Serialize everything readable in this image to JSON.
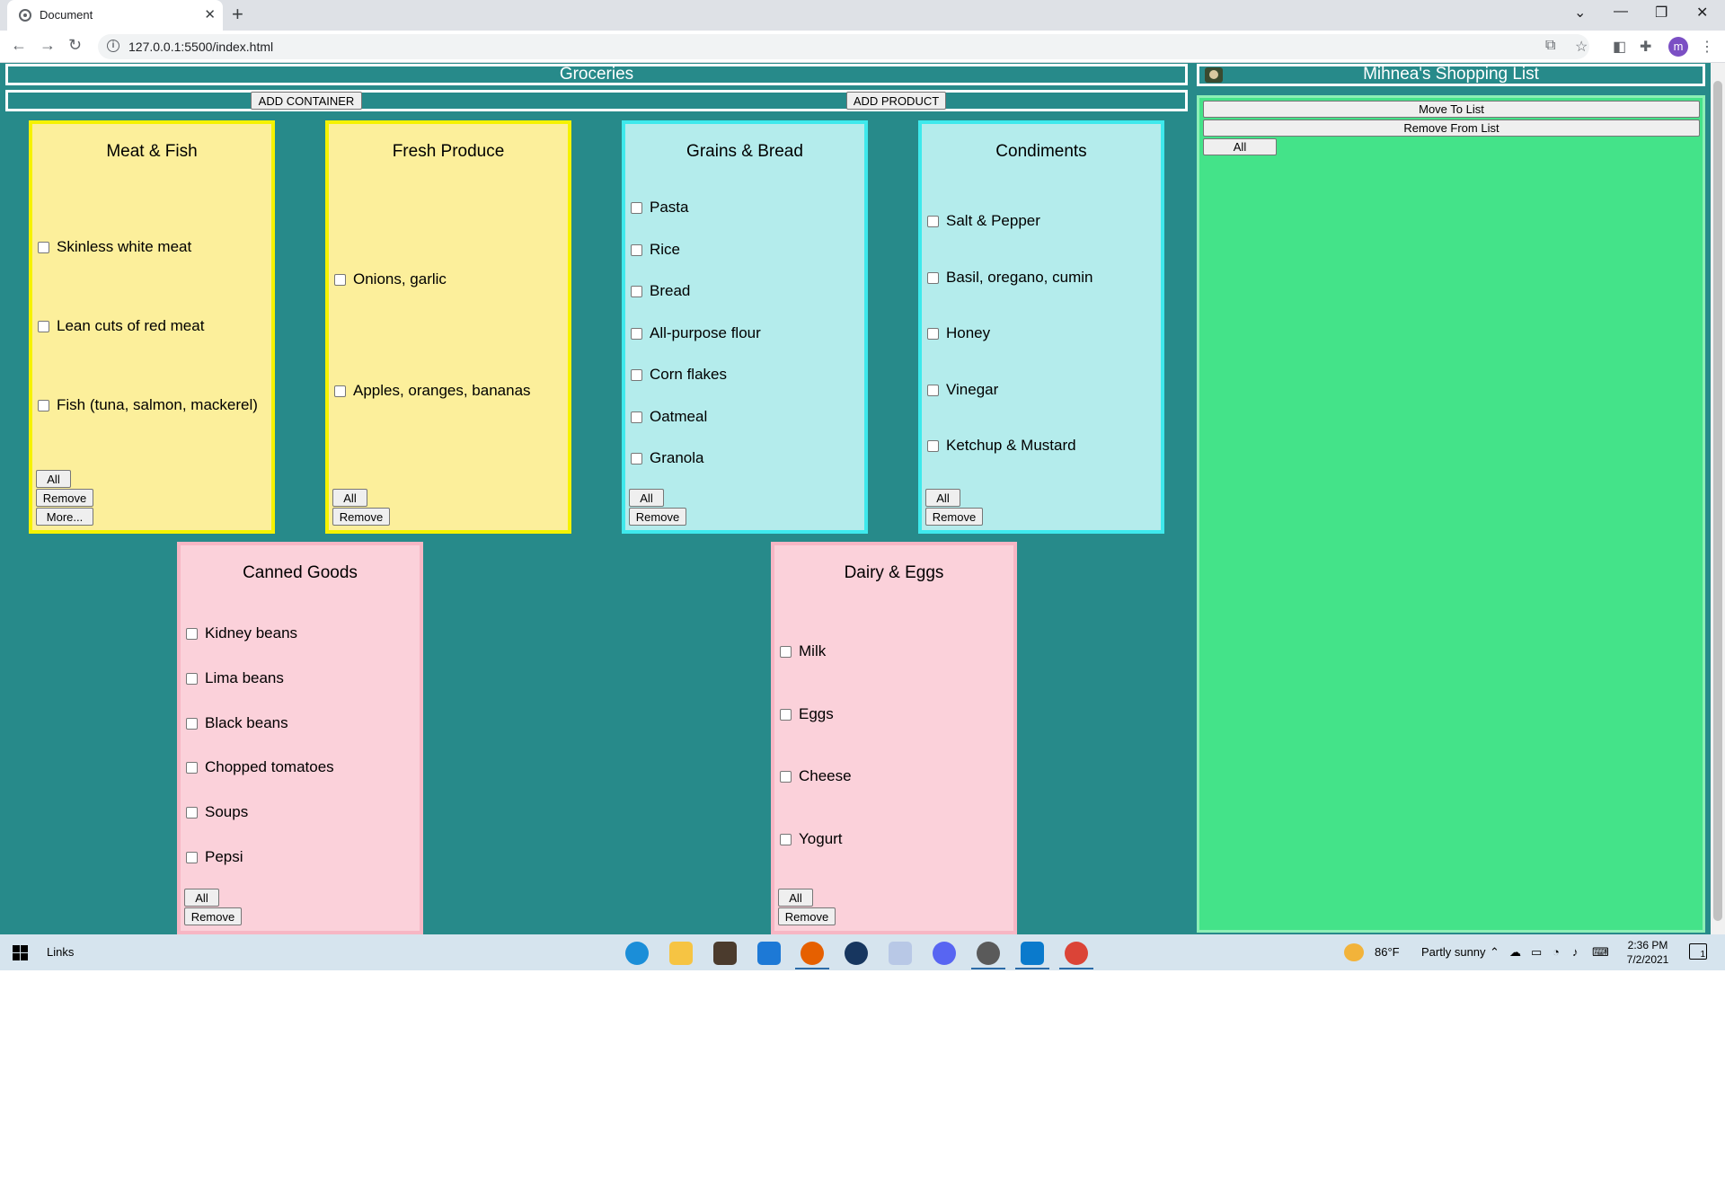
{
  "browser": {
    "tab_title": "Document",
    "tab_close": "✕",
    "new_tab": "+",
    "url": "127.0.0.1:5500/index.html",
    "profile_initial": "m",
    "window_controls": {
      "tab_search": "⌄",
      "minimize": "—",
      "restore": "❐",
      "close": "✕"
    },
    "nav": {
      "back": "←",
      "forward": "→",
      "reload": "↻"
    },
    "toolbar_icons": [
      "translate-icon",
      "star-icon",
      "extension-icon",
      "puzzle-icon",
      "menu-icon"
    ]
  },
  "page": {
    "header_title": "Groceries",
    "add_container_label": "ADD CONTAINER",
    "add_product_label": "ADD PRODUCT",
    "containers": [
      {
        "title": "Meat & Fish",
        "color": "yellow",
        "items": [
          "Skinless white meat",
          "Lean cuts of red meat",
          "Fish (tuna, salmon, mackerel)"
        ],
        "buttons": [
          "All",
          "Remove",
          "More..."
        ]
      },
      {
        "title": "Fresh Produce",
        "color": "yellow",
        "items": [
          "Onions, garlic",
          "Apples, oranges, bananas"
        ],
        "buttons": [
          "All",
          "Remove"
        ]
      },
      {
        "title": "Grains & Bread",
        "color": "cyan",
        "items": [
          "Pasta",
          "Rice",
          "Bread",
          "All-purpose flour",
          "Corn flakes",
          "Oatmeal",
          "Granola"
        ],
        "buttons": [
          "All",
          "Remove"
        ]
      },
      {
        "title": "Condiments",
        "color": "cyan",
        "items": [
          "Salt & Pepper",
          "Basil, oregano, cumin",
          "Honey",
          "Vinegar",
          "Ketchup & Mustard"
        ],
        "buttons": [
          "All",
          "Remove"
        ]
      },
      {
        "title": "Canned Goods",
        "color": "pink",
        "items": [
          "Kidney beans",
          "Lima beans",
          "Black beans",
          "Chopped tomatoes",
          "Soups",
          "Pepsi"
        ],
        "buttons": [
          "All",
          "Remove"
        ]
      },
      {
        "title": "Dairy & Eggs",
        "color": "pink",
        "items": [
          "Milk",
          "Eggs",
          "Cheese",
          "Yogurt"
        ],
        "buttons": [
          "All",
          "Remove"
        ]
      }
    ],
    "shopping_list": {
      "title": "Mihnea's Shopping List",
      "move_label": "Move To List",
      "remove_label": "Remove From List",
      "all_label": "All"
    }
  },
  "taskbar": {
    "search_label": "Links",
    "weather": "86°F",
    "weather_desc": "Partly sunny",
    "time": "2:36 PM",
    "date": "7/2/2021",
    "notification_count": "1"
  },
  "colors": {
    "page_bg": "#278a8a",
    "yellow_bg": "#fcef9b",
    "yellow_border": "#f5f200",
    "cyan_bg": "#b4ecec",
    "cyan_border": "#3ee9ec",
    "pink_bg": "#fbd1da",
    "pink_border": "#f7b6c4",
    "list_bg": "#44e389"
  }
}
